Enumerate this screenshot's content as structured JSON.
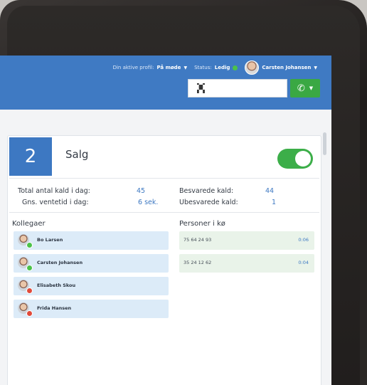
{
  "header": {
    "profile_label": "Din aktive profil:",
    "profile_value": "På møde",
    "status_label": "Status:",
    "status_value": "Ledig",
    "user_name": "Carsten Johansen",
    "dial_value": "",
    "colors": {
      "header_bg": "#3f7ac3",
      "call_button": "#3aa843",
      "status_available": "#4cc24a"
    }
  },
  "queue": {
    "number": "2",
    "name": "Salg",
    "enabled": true,
    "stats": {
      "total_calls_label": "Total antal kald i dag:",
      "total_calls_value": "45",
      "avg_wait_label": "Gns. ventetid i dag:",
      "avg_wait_value": "6 sek.",
      "answered_label": "Besvarede kald:",
      "answered_value": "44",
      "unanswered_label": "Ubesvarede kald:",
      "unanswered_value": "1"
    }
  },
  "colleagues": {
    "title": "Kollegaer",
    "items": [
      {
        "name": "Bo Larsen",
        "status_color": "#4cc24a"
      },
      {
        "name": "Carsten Johansen",
        "status_color": "#4cc24a"
      },
      {
        "name": "Elisabeth Skou",
        "status_color": "#e04a3a"
      },
      {
        "name": "Frida Hansen",
        "status_color": "#e04a3a"
      }
    ]
  },
  "queue_persons": {
    "title": "Personer i kø",
    "items": [
      {
        "number": "75 64 24 93",
        "wait": "0:06"
      },
      {
        "number": "35 24 12 62",
        "wait": "0:04"
      }
    ]
  },
  "icons": {
    "qr": "qr-code-icon",
    "phone": "phone-icon",
    "chevron": "chevron-down-icon",
    "avatar": "avatar-icon"
  }
}
